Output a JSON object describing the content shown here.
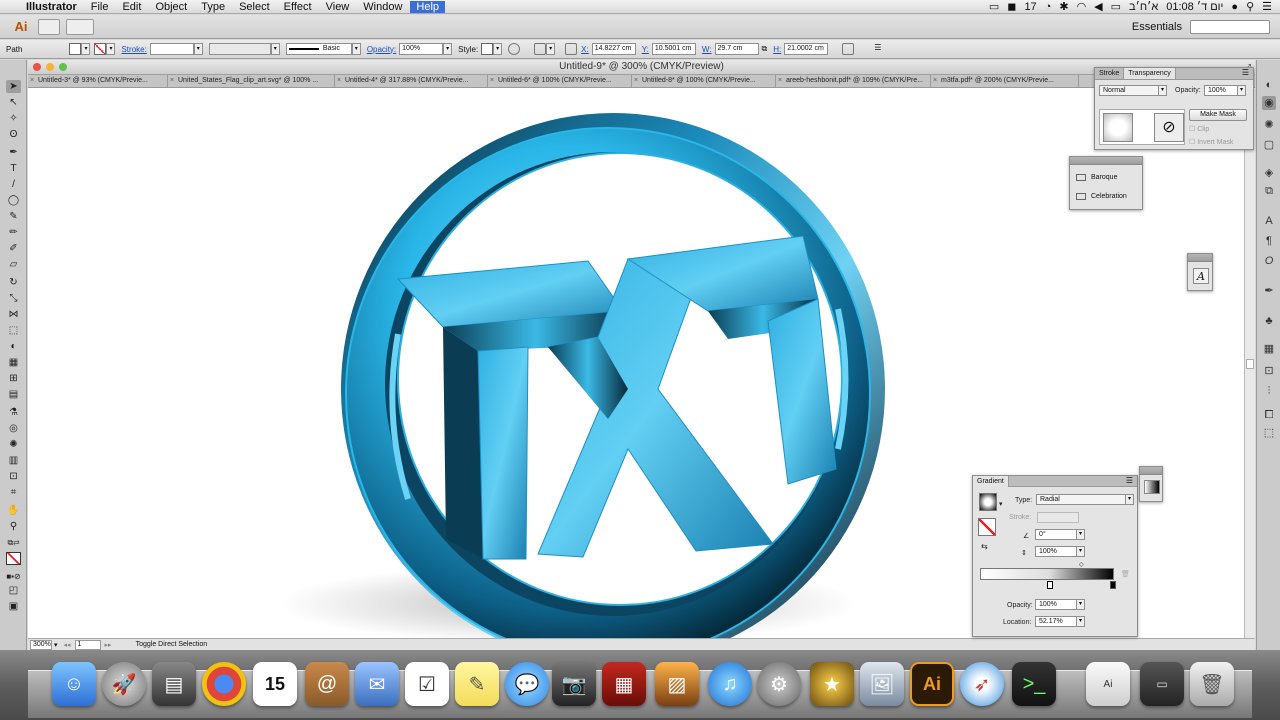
{
  "menubar": {
    "app": "Illustrator",
    "items": [
      "File",
      "Edit",
      "Object",
      "Type",
      "Select",
      "Effect",
      "View",
      "Window",
      "Help"
    ],
    "battery": "17",
    "clock": "יום ד׳ 01:08",
    "date": "א׳ח׳ב"
  },
  "appbar": {
    "workspace": "Essentials"
  },
  "control": {
    "selection": "Path",
    "stroke_label": "Stroke:",
    "brush": "Basic",
    "opacity_label": "Opacity:",
    "opacity": "100%",
    "style_label": "Style:",
    "x_label": "X:",
    "x": "14.8227 cm",
    "y_label": "Y:",
    "y": "10.5001 cm",
    "w_label": "W:",
    "w": "29.7 cm",
    "h_label": "H:",
    "h": "21.0002 cm"
  },
  "document": {
    "title": "Untitled-9* @ 300% (CMYK/Preview)",
    "tabs": [
      "Untitled-3* @ 93% (CMYK/Previe...",
      "United_States_Flag_clip_art.svg* @ 100% ...",
      "Untitled-4* @ 317.88% (CMYK/Previe...",
      "Untitled-6* @ 100% (CMYK/Previe...",
      "Untitled-8* @ 100% (CMYK/Previe...",
      "areeb-heshbonit.pdf* @ 109% (CMYK/Pre...",
      "m3tfa.pdf* @ 200% (CMYK/Previe..."
    ],
    "zoom": "300%",
    "page": "1",
    "status": "Toggle Direct Selection"
  },
  "transparency_panel": {
    "tab_stroke": "Stroke",
    "tab_transparency": "Transparency",
    "blend_mode": "Normal",
    "opacity_label": "Opacity:",
    "opacity": "100%",
    "make_mask": "Make Mask",
    "clip": "Clip",
    "invert_mask": "Invert Mask"
  },
  "brush_panel": {
    "items": [
      "Baroque",
      "Celebration"
    ]
  },
  "gradient_panel": {
    "title": "Gradient",
    "type_label": "Type:",
    "type": "Radial",
    "stroke_label": "Stroke:",
    "angle": "0°",
    "aspect": "100%",
    "opacity_label": "Opacity:",
    "opacity": "100%",
    "location_label": "Location:",
    "location": "52.17%"
  },
  "dock_calendar_day": "15",
  "colors": {
    "accent_blue": "#29b6e8",
    "ai_orange": "#f19b1a"
  }
}
